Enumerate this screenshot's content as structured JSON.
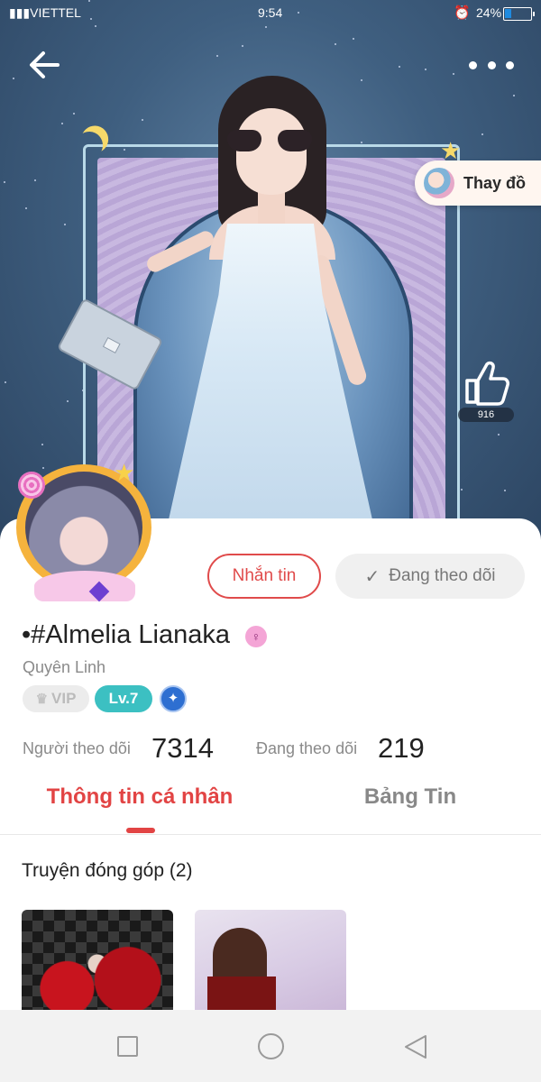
{
  "status_bar": {
    "carrier": "VIETTEL",
    "time": "9:54",
    "battery": "24%",
    "battery_level": 0.24
  },
  "hero": {
    "outfit_button_label": "Thay đồ",
    "like_count": "916"
  },
  "profile": {
    "message_button": "Nhắn tin",
    "following_button": "Đang theo dõi",
    "display_name": "•#Almelia Lianaka",
    "gender_symbol": "♀",
    "username": "Quyên Linh",
    "vip_label": "VIP",
    "level_label": "Lv.7",
    "followers_label": "Người theo dõi",
    "followers_count": "7314",
    "following_label": "Đang theo dõi",
    "following_count": "219"
  },
  "tabs": [
    {
      "label": "Thông tin cá nhân",
      "active": true
    },
    {
      "label": "Bảng Tin",
      "active": false
    }
  ],
  "contributions": {
    "title": "Truyện đóng góp (2)",
    "covers": [
      "cover-art",
      "cover-art"
    ]
  },
  "icons": {
    "back": "arrow-left-icon",
    "more": "more-dots-icon",
    "like": "thumbs-up-icon",
    "check": "check-icon",
    "crown": "crown-icon",
    "rank": "rank-emblem-icon",
    "nav": [
      "square-icon",
      "circle-icon",
      "triangle-back-icon"
    ]
  },
  "colors": {
    "accent": "#e24444",
    "level_badge": "#3cc0c2",
    "battery_fill": "#1f8be0"
  }
}
